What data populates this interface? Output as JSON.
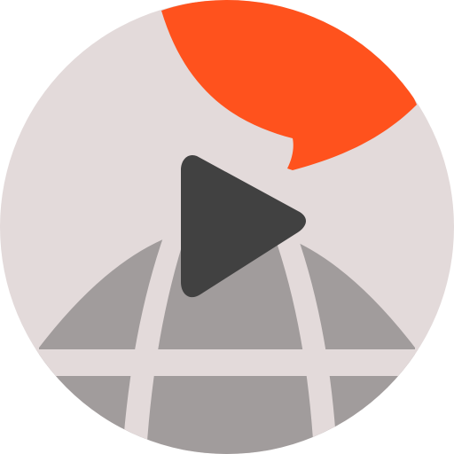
{
  "icon": {
    "name": "video-globe-chat-icon",
    "colors": {
      "background_circle": "#E3DADA",
      "speech_bubble": "#FF521D",
      "play_triangle": "#414141",
      "globe": "#A19C9C",
      "globe_grid": "#E3DADA"
    }
  }
}
